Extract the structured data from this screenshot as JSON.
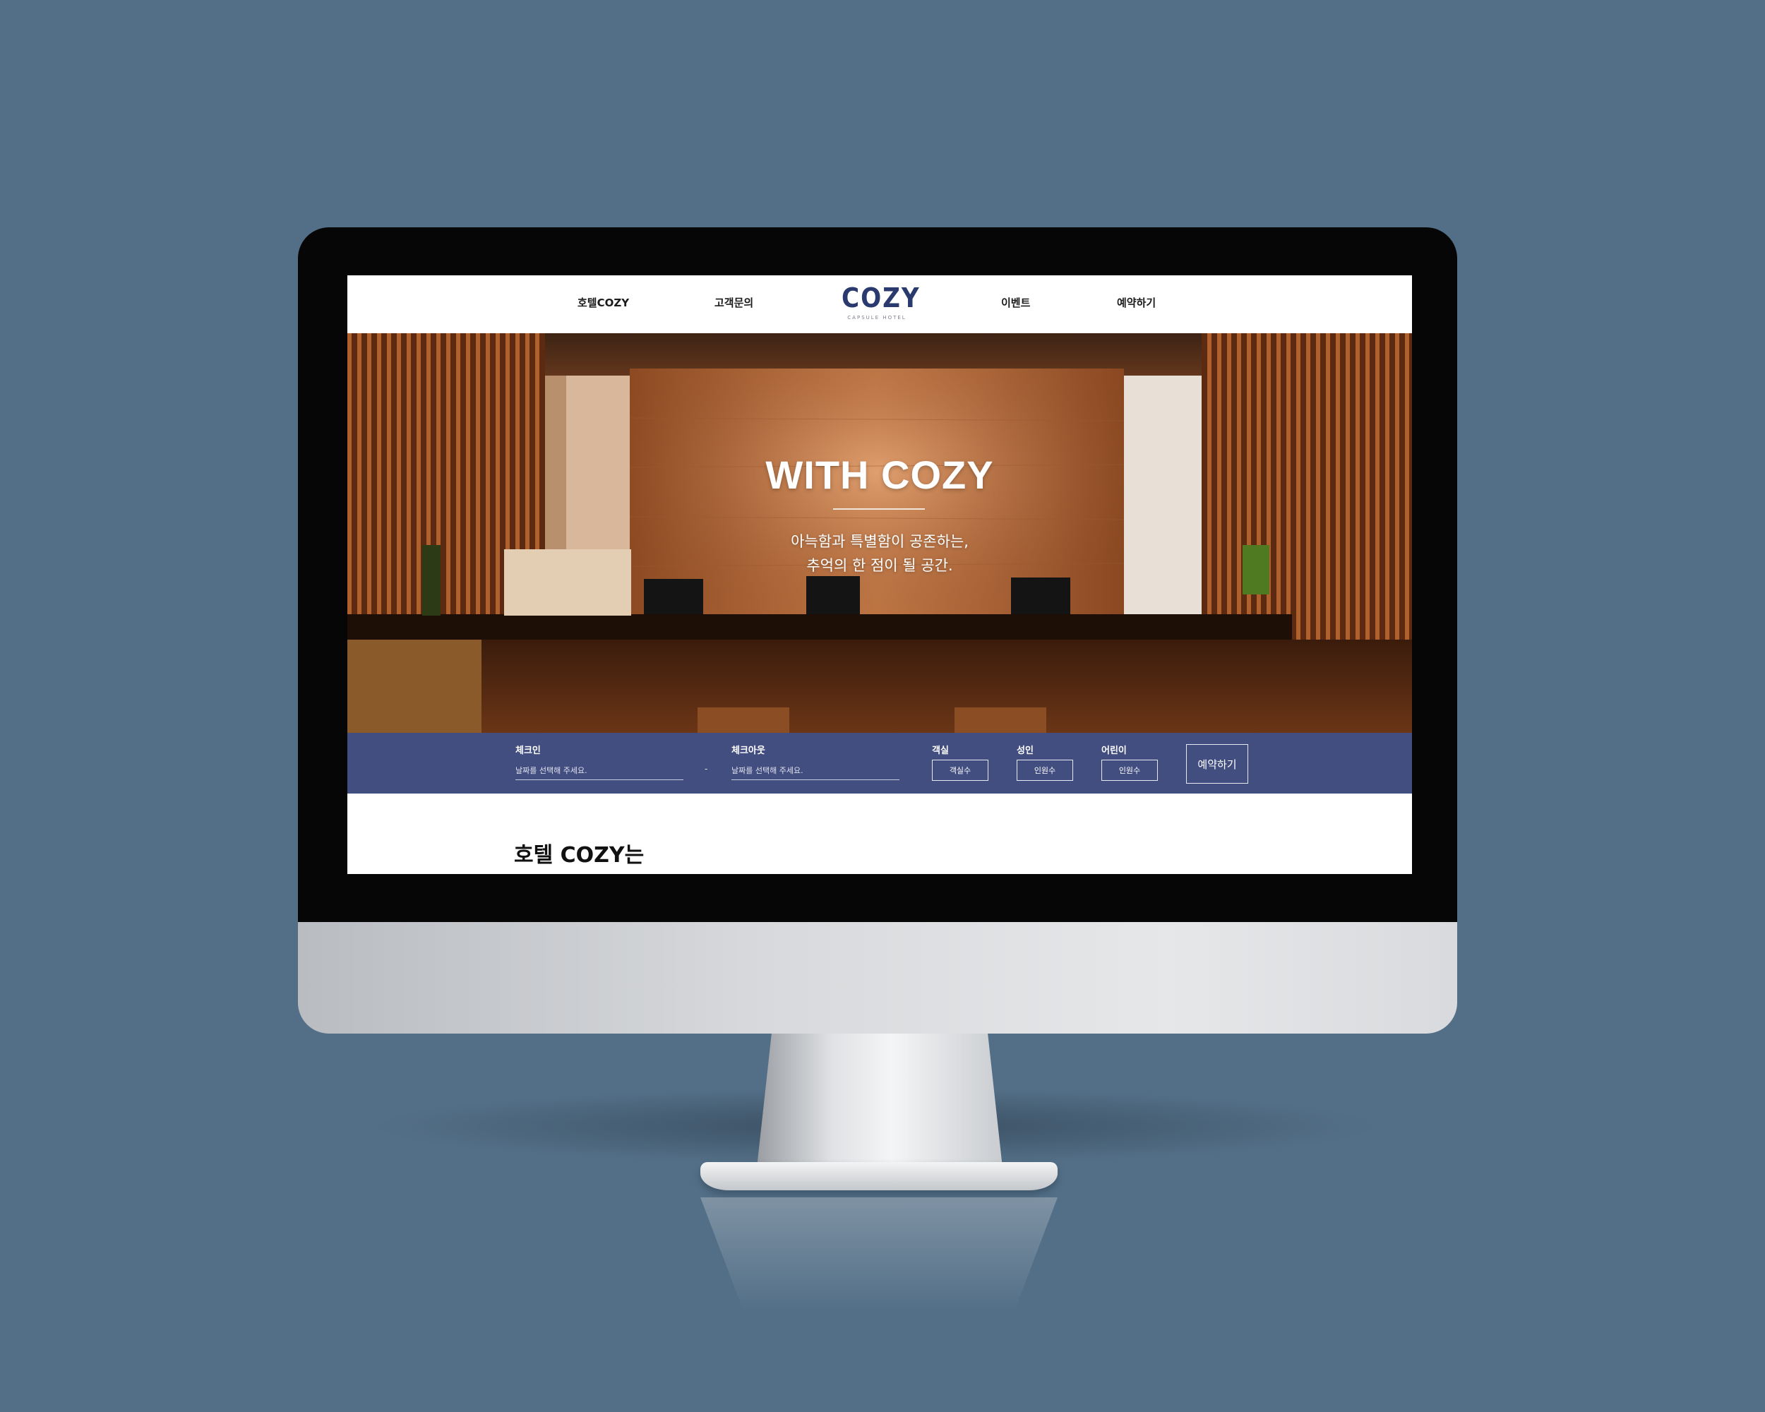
{
  "nav": {
    "items": [
      {
        "label": "호텔COZY"
      },
      {
        "label": "고객문의"
      },
      {
        "label": "이벤트"
      },
      {
        "label": "예약하기"
      }
    ],
    "logo": {
      "text": "COZY",
      "subtitle": "CAPSULE HOTEL"
    }
  },
  "hero": {
    "title": "WITH COZY",
    "subtitle_line1": "아늑함과 특별함이 공존하는,",
    "subtitle_line2": "추억의 한 점이 될 공간."
  },
  "booking": {
    "checkin_label": "체크인",
    "checkin_placeholder": "날짜를 선택해 주세요.",
    "separator": "-",
    "checkout_label": "체크아웃",
    "checkout_placeholder": "날짜를 선택해 주세요.",
    "room_label": "객실",
    "room_value": "객실수",
    "adult_label": "성인",
    "adult_value": "인원수",
    "child_label": "어린이",
    "child_value": "인원수",
    "submit_label": "예약하기"
  },
  "section": {
    "heading": "호텔 COZY는"
  },
  "colors": {
    "background": "#536f87",
    "booking_bar": "#434e80",
    "logo": "#2a3a6e"
  }
}
